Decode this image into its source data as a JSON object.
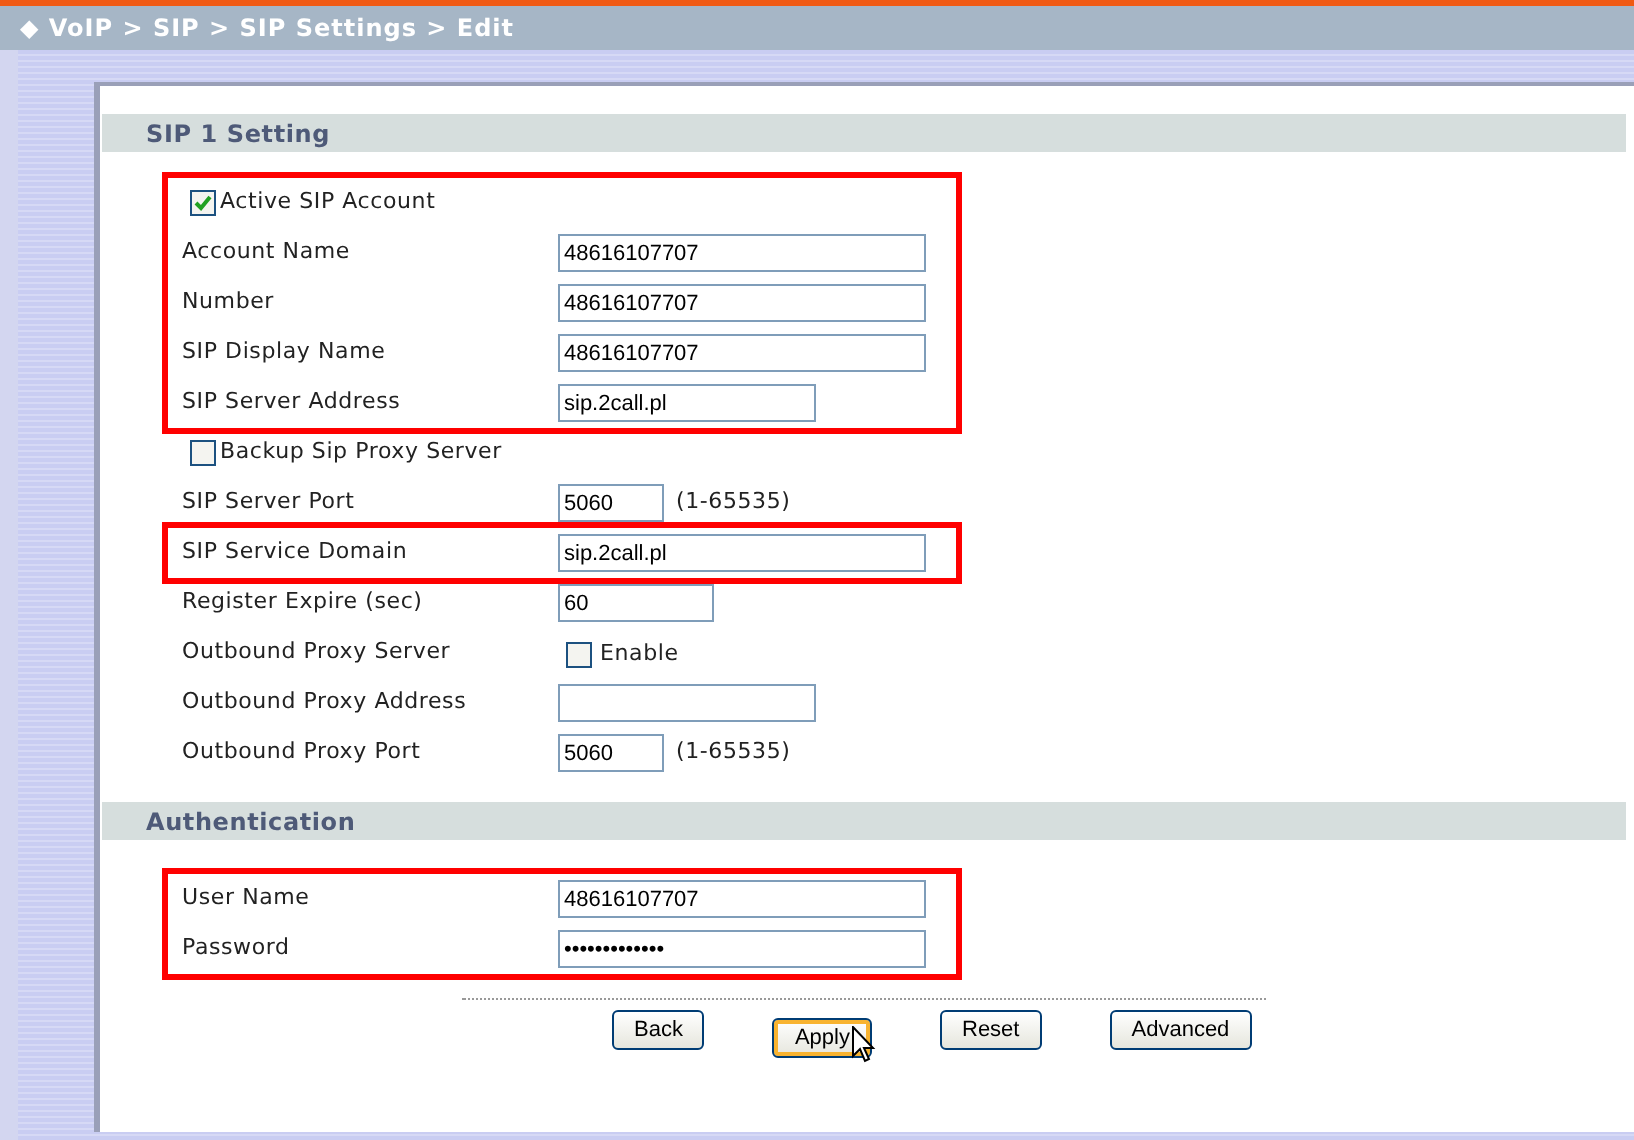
{
  "breadcrumb": "◆ VoIP > SIP > SIP Settings > Edit",
  "sections": [
    {
      "title": "SIP 1 Setting",
      "groups": [
        {
          "highlighted": true,
          "rows": [
            {
              "kind": "checkbox",
              "label": "Active SIP Account",
              "checked": true
            },
            {
              "kind": "long_field",
              "label": "Account Name",
              "value": "48616107707"
            },
            {
              "kind": "long_field",
              "label": "Number",
              "value": "48616107707"
            },
            {
              "kind": "long_field",
              "label": "SIP Display Name",
              "value": "48616107707"
            },
            {
              "kind": "medium_field",
              "label": "SIP Server Address",
              "value": "sip.2call.pl"
            }
          ]
        },
        {
          "highlighted": false,
          "rows": [
            {
              "kind": "checkbox",
              "label": "Backup Sip Proxy Server",
              "checked": false
            },
            {
              "kind": "short_field",
              "label": "SIP Server Port",
              "value": "5060",
              "hint": "(1-65535)"
            }
          ]
        },
        {
          "highlighted": true,
          "rows": [
            {
              "kind": "long_field",
              "label": "SIP Service Domain",
              "value": "sip.2call.pl"
            }
          ]
        },
        {
          "highlighted": false,
          "rows": [
            {
              "kind": "small_field",
              "label": "Register Expire (sec)",
              "value": "60"
            },
            {
              "kind": "option",
              "label": "Outbound Proxy Server",
              "option": "Enable",
              "checked": false
            },
            {
              "kind": "medium_field",
              "label": "Outbound Proxy Address"
            },
            {
              "kind": "short_field",
              "label": "Outbound Proxy Port",
              "value": "5060",
              "hint": "(1-65535)"
            }
          ]
        }
      ]
    },
    {
      "title": "Authentication",
      "groups": [
        {
          "highlighted": true,
          "rows": [
            {
              "kind": "long_field",
              "label": "User Name",
              "value": "48616107707"
            },
            {
              "kind": "long_field",
              "label": "Password",
              "value": "•••••••••••••"
            }
          ]
        }
      ]
    }
  ],
  "buttons": [
    {
      "label": "Back",
      "focused": false
    },
    {
      "label": "Apply",
      "focused": true
    },
    {
      "label": "Reset",
      "focused": false
    },
    {
      "label": "Advanced",
      "focused": false
    }
  ]
}
